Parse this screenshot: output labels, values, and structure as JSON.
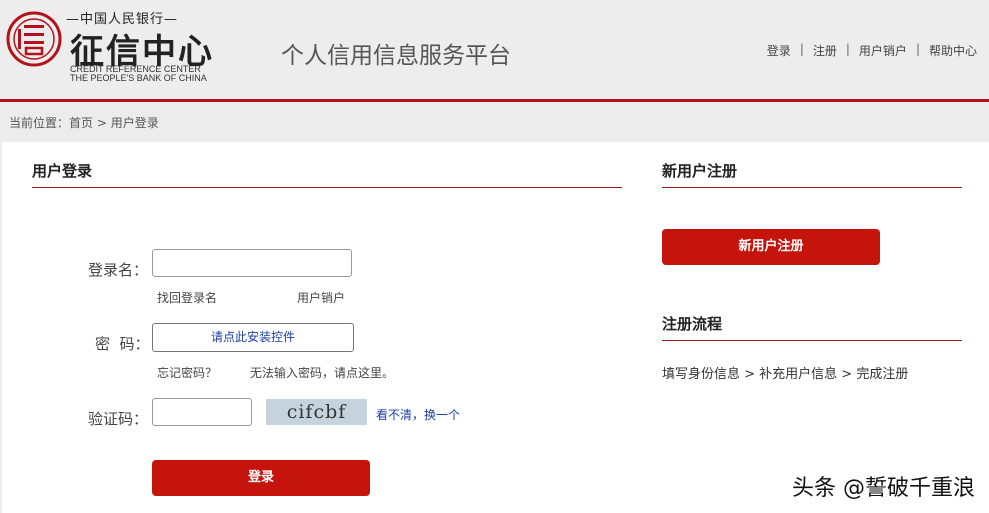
{
  "header": {
    "logo_top": "—中国人民银行—",
    "logo_main": "征信中心",
    "logo_en_line1": "CREDIT REFERENCE  CENTER",
    "logo_en_line2": "THE PEOPLE'S BANK OF CHINA",
    "platform_title": "个人信用信息服务平台",
    "nav": [
      "登录",
      "注册",
      "用户销户",
      "帮助中心"
    ],
    "nav_separator": "|"
  },
  "breadcrumb": {
    "prefix": "当前位置：",
    "home": "首页",
    "separator": " > ",
    "current": "用户登录"
  },
  "login": {
    "title": "用户登录",
    "username_label": "登录名：",
    "username_value": "",
    "find_username_link": "找回登录名",
    "cancel_account_link": "用户销户",
    "password_label": "密  码：",
    "install_control_button": "请点此安装控件",
    "forgot_password_link": "忘记密码？",
    "cannot_input_link": "无法输入密码，请点这里。",
    "captcha_label": "验证码：",
    "captcha_value": "",
    "captcha_text": "cifcbf",
    "captcha_refresh_link": "看不清，换一个",
    "submit_button": "登录"
  },
  "register": {
    "title": "新用户注册",
    "button": "新用户注册",
    "flow_title": "注册流程",
    "flow_steps": "填写身份信息 > 补充用户信息 > 完成注册"
  },
  "watermark": "头条 @誓破千重浪",
  "colors": {
    "accent_red": "#c4140c",
    "line_red": "#9b1b20",
    "link_blue": "#1a3ea8"
  }
}
